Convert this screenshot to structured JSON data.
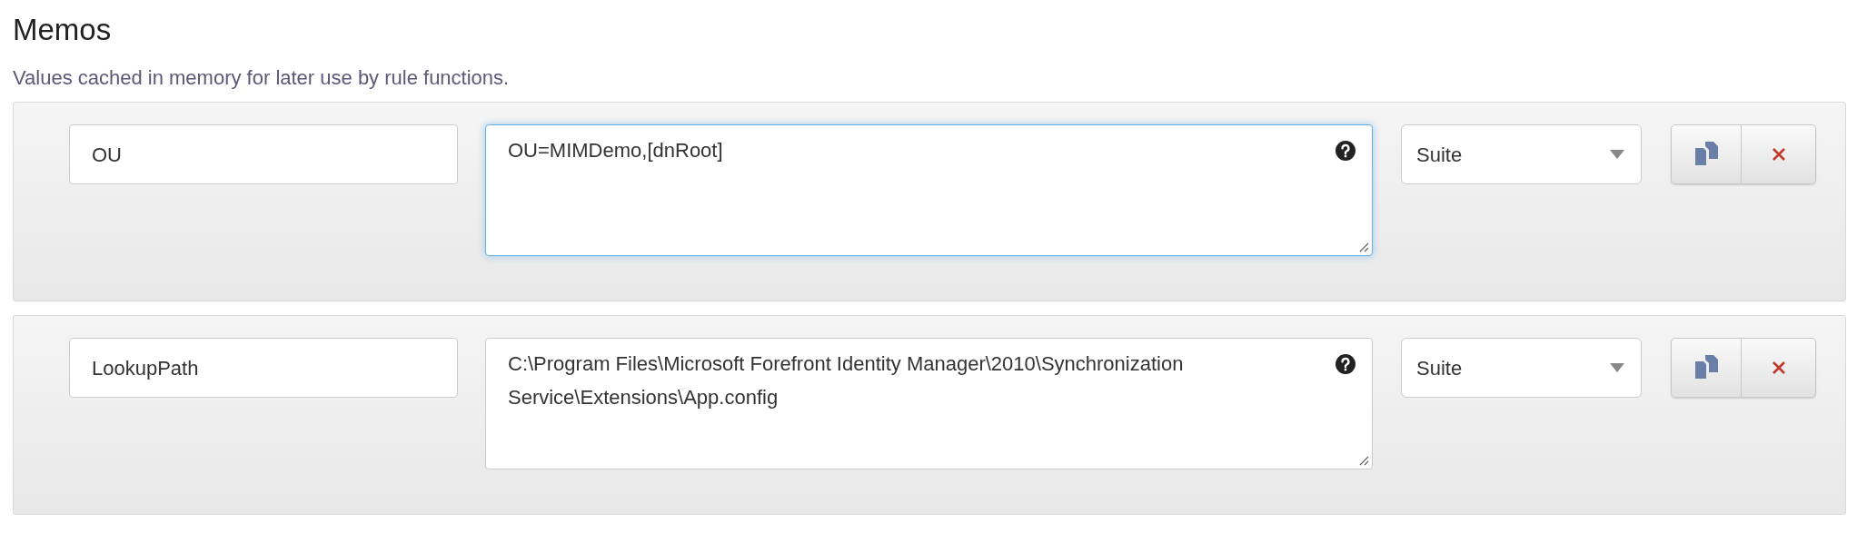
{
  "section": {
    "title": "Memos",
    "description": "Values cached in memory for later use by rule functions."
  },
  "memos": [
    {
      "name": "OU",
      "value": "OU=MIMDemo,[dnRoot]",
      "focused": true,
      "scope": "Suite"
    },
    {
      "name": "LookupPath",
      "value": "C:\\Program Files\\Microsoft Forefront Identity Manager\\2010\\Synchronization Service\\Extensions\\App.config",
      "focused": false,
      "scope": "Suite"
    }
  ]
}
